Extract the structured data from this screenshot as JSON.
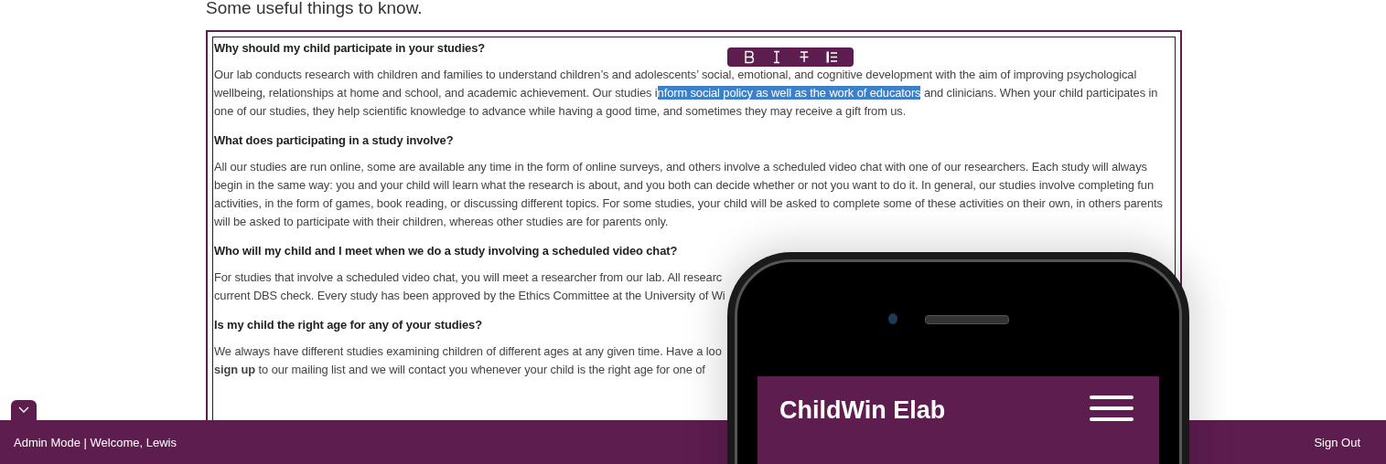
{
  "page_heading": "Some useful things to know.",
  "editor": {
    "toolbar": [
      {
        "kind": "bold"
      },
      {
        "kind": "italic"
      },
      {
        "kind": "strikethrough"
      },
      {
        "kind": "list"
      }
    ],
    "blocks": [
      {
        "kind": "question",
        "text": "Why should my child participate in your studies?"
      },
      {
        "kind": "answer",
        "text": "Our lab conducts research with children and families to understand children’s and adolescents’ social, emotional, and cognitive development with the aim of improving psychological wellbeing, relationships at home and school, and academic achievement. Our studies i",
        "selection": "nform social policy as well as the work of educators",
        "text_after": " and clinicians. When your child participates in one of our studies, they help scientific knowledge to advance while having a good time, and sometimes they may receive a gift from us."
      },
      {
        "kind": "question",
        "text": "What does participating in a study involve?"
      },
      {
        "kind": "answer",
        "text": "All our studies are run online, some are available any time in the form of online surveys, and others involve a scheduled video chat with one of our researchers. Each study will always begin in the same way: you and your child will learn what the research is about, and you both can decide whether or not you want to do it. In general, our studies involve completing fun activities, in the form of games, book reading, or discussing different topics. For some studies, your child will be asked to complete some of these activities on their own, in others parents will be asked to participate with their children, whereas other studies are for parents only."
      },
      {
        "kind": "question",
        "text": "Who will my child and I meet when we do a study involving a scheduled video chat?"
      },
      {
        "kind": "answer",
        "lines": [
          "For studies that involve a scheduled video chat, you will meet a researcher from our lab. All researc",
          "current DBS check. Every study has been approved by the Ethics Committee at the University of Wi"
        ]
      },
      {
        "kind": "question",
        "text": "Is my child the right age for any of your studies?"
      },
      {
        "kind": "answer",
        "lines": [
          "We always have different studies examining children of different ages at any given time. Have a loo",
          "**sign up** to our mailing list and we will contact you whenever your child is the right age for one of"
        ]
      }
    ]
  },
  "phone_preview": {
    "site_title": "ChildWin Elab"
  },
  "admin_bar": {
    "status": "Admin Mode | Welcome, Lewis",
    "sign_out": "Sign Out"
  }
}
